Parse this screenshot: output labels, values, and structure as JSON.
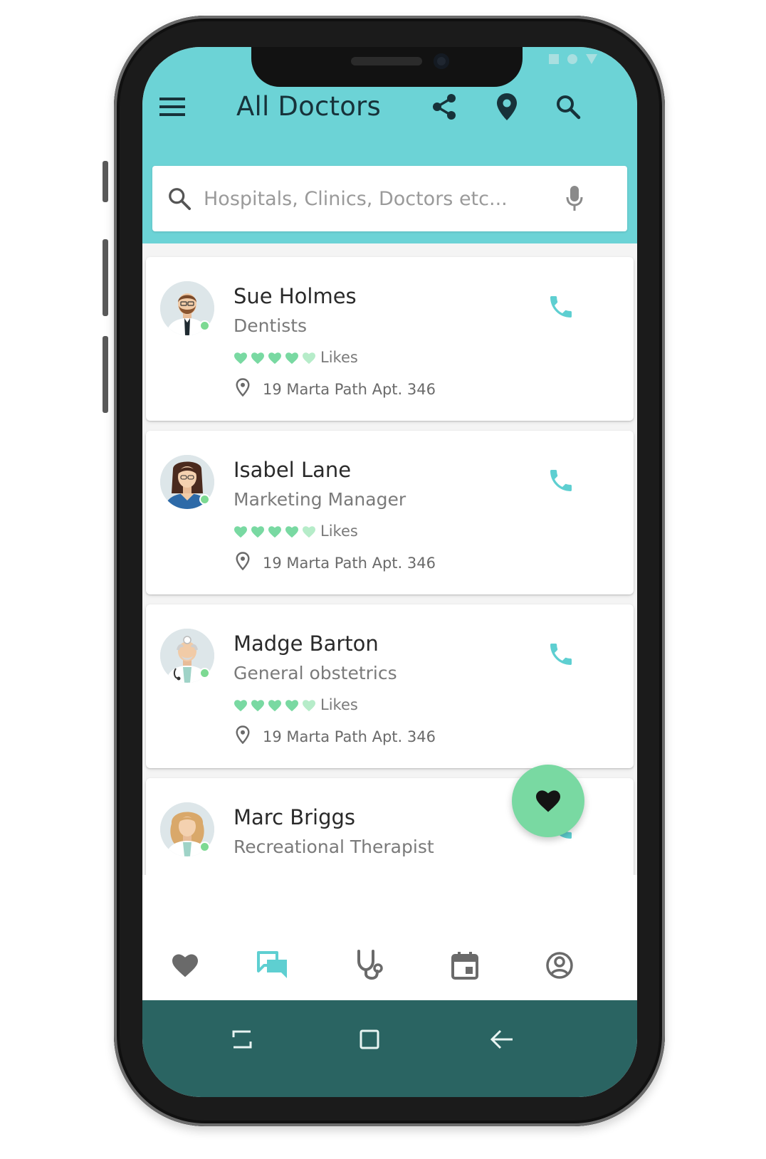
{
  "colors": {
    "header": "#6cd3d6",
    "accent": "#5ecfd1",
    "heart": "#79d9a2",
    "online": "#7cd992",
    "system_bar": "#2a6462",
    "title_text": "#17323a"
  },
  "header": {
    "title": "All Doctors",
    "menu_icon": "menu-icon",
    "share_icon": "share-icon",
    "location_icon": "location-pin-icon",
    "search_icon": "search-icon"
  },
  "search": {
    "placeholder": "Hospitals, Clinics, Doctors etc...",
    "icon": "search-icon",
    "mic_icon": "microphone-icon"
  },
  "doctors": [
    {
      "name": "Sue Holmes",
      "specialty": "Dentists",
      "likes_label": "Likes",
      "rating": 5,
      "address": "19 Marta Path Apt. 346",
      "online": true
    },
    {
      "name": "Isabel Lane",
      "specialty": "Marketing Manager",
      "likes_label": "Likes",
      "rating": 5,
      "address": "19 Marta Path Apt. 346",
      "online": true
    },
    {
      "name": "Madge Barton",
      "specialty": "General obstetrics",
      "likes_label": "Likes",
      "rating": 5,
      "address": "19 Marta Path Apt. 346",
      "online": true
    },
    {
      "name": "Marc Briggs",
      "specialty": "Recreational Therapist",
      "online": true
    }
  ],
  "fab": {
    "icon": "heart-icon"
  },
  "bottom_nav": [
    {
      "icon": "heart-icon",
      "active": false
    },
    {
      "icon": "chat-icon",
      "active": true
    },
    {
      "icon": "stethoscope-icon",
      "active": false
    },
    {
      "icon": "calendar-icon",
      "active": false
    },
    {
      "icon": "account-icon",
      "active": false
    }
  ],
  "system_nav": [
    {
      "icon": "recents-icon"
    },
    {
      "icon": "home-icon"
    },
    {
      "icon": "back-icon"
    }
  ]
}
